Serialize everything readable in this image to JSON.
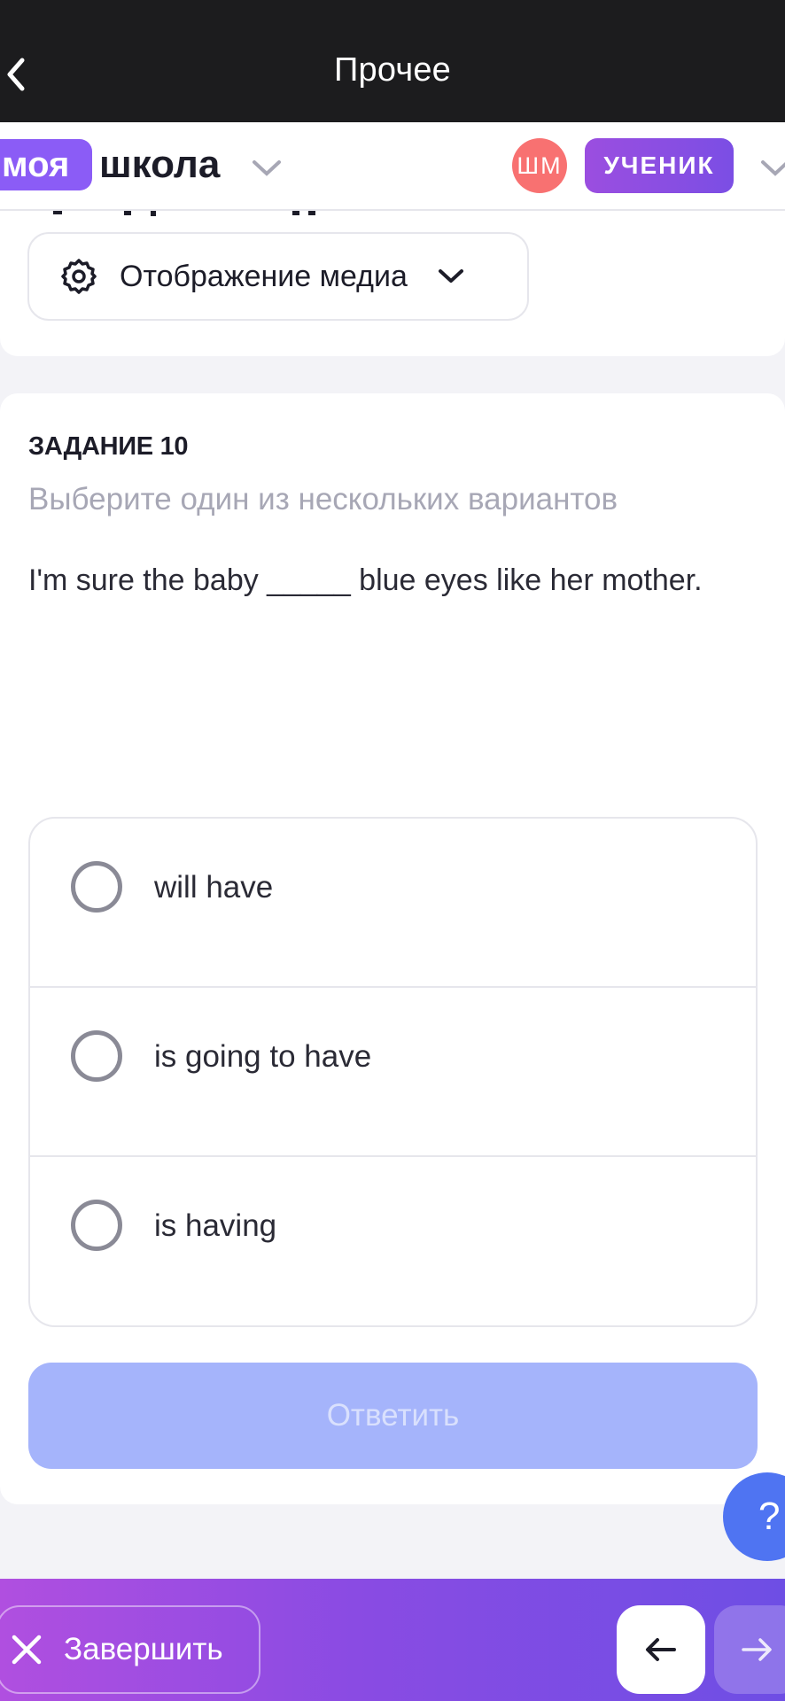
{
  "topbar": {
    "title": "Прочее",
    "back_icon": "chevron-left-icon"
  },
  "school_header": {
    "logo_badge": "моя",
    "logo_text": "школа",
    "avatar_initials": "ШМ",
    "role": "УЧЕНИК",
    "colors": {
      "logo": "#8b5cf6",
      "avatar": "#f87171",
      "role": "#8b4ee2"
    }
  },
  "media": {
    "label": "Отображение медиа",
    "icon": "gear-icon"
  },
  "task": {
    "title": "ЗАДАНИЕ 10",
    "subtitle": "Выберите один из нескольких вариантов",
    "question": "I'm sure the baby _____ blue eyes like her mother.",
    "options": [
      {
        "label": "will have",
        "selected": false
      },
      {
        "label": "is going to have",
        "selected": false
      },
      {
        "label": "is having",
        "selected": false
      }
    ],
    "answer_button": "Ответить"
  },
  "help_button": "?",
  "bottombar": {
    "finish_label": "Завершить",
    "finish_icon": "close-icon",
    "prev_icon": "arrow-left-icon",
    "next_icon": "arrow-right-icon"
  }
}
